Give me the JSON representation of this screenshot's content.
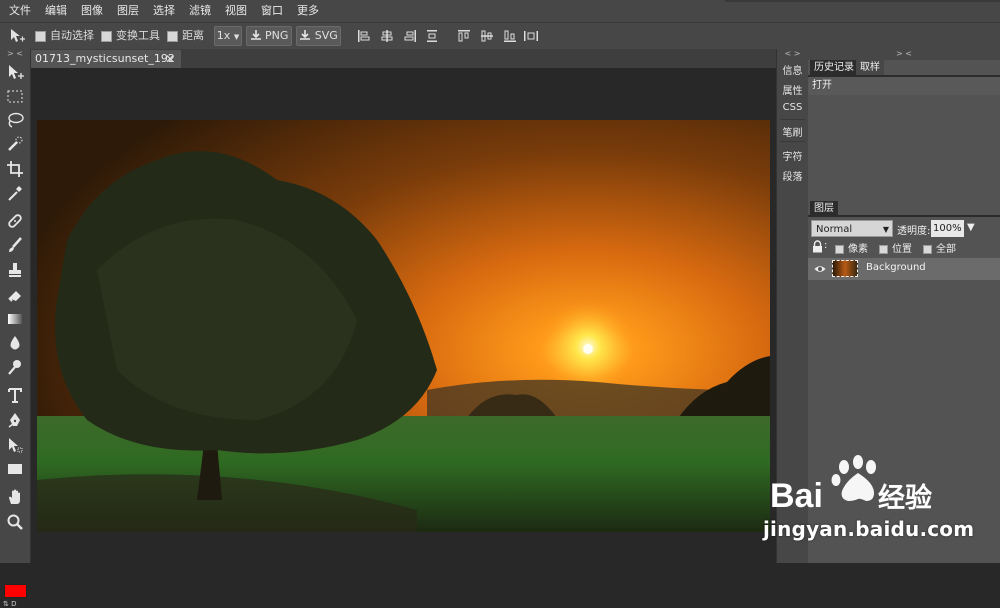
{
  "menubar": {
    "items": [
      "文件",
      "编辑",
      "图像",
      "图层",
      "选择",
      "滤镜",
      "视图",
      "窗口",
      "更多"
    ]
  },
  "options": {
    "auto_select": "自动选择",
    "transform_tools": "变换工具",
    "distance": "距离",
    "zoom": "1x",
    "export_png": "PNG",
    "export_svg": "SVG"
  },
  "panel_collapse": {
    "left": "> <",
    "mid": "< >",
    "right": "> <"
  },
  "document": {
    "tab_title": "01713_mysticsunset_192",
    "close": "✕"
  },
  "mid_panel": {
    "tabs": [
      "信息",
      "属性",
      "CSS",
      "笔刷",
      "字符",
      "段落"
    ]
  },
  "right_panel": {
    "history_tab": "历史记录",
    "swatches_tab": "取样",
    "history_items": [
      "打开"
    ],
    "layers_tab": "图层",
    "blend_mode": "Normal",
    "opacity_label": "透明度:",
    "opacity": "100%",
    "opacity_arrow": "▼",
    "lock_label": ":",
    "lock_pixels": "像素",
    "lock_position": "位置",
    "lock_all": "全部",
    "layers": [
      {
        "name": "Background"
      }
    ]
  },
  "colors": {
    "foreground": "#ff0000",
    "panel_bg": "#474747",
    "canvas_bg": "#282828"
  },
  "toolbar_icons": [
    "move-tool-icon",
    "marquee-tool-icon",
    "lasso-tool-icon",
    "quick-select-icon",
    "crop-icon",
    "eyedropper-icon",
    "spot-heal-icon",
    "brush-icon",
    "stamp-icon",
    "eraser-icon",
    "gradient-icon",
    "blur-icon",
    "dodge-icon",
    "text-tool-icon",
    "pen-tool-icon",
    "path-select-icon",
    "rectangle-tool-icon",
    "hand-tool-icon",
    "zoom-tool-icon"
  ],
  "watermark": {
    "text": "jingyan.baidu.com",
    "logo": "Bai经验"
  }
}
